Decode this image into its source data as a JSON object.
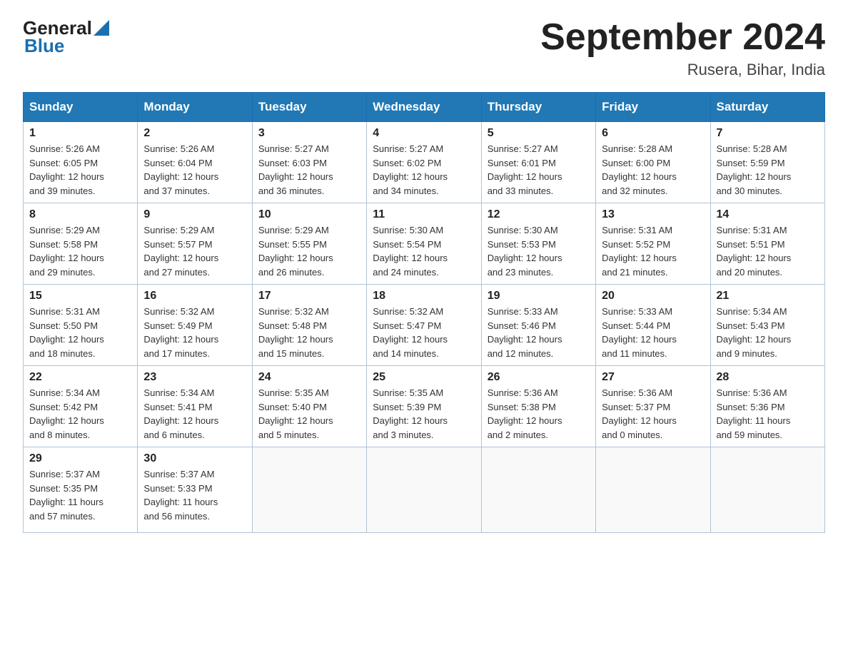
{
  "header": {
    "logo_general": "General",
    "logo_blue": "Blue",
    "title": "September 2024",
    "subtitle": "Rusera, Bihar, India"
  },
  "days_of_week": [
    "Sunday",
    "Monday",
    "Tuesday",
    "Wednesday",
    "Thursday",
    "Friday",
    "Saturday"
  ],
  "weeks": [
    [
      {
        "day": "1",
        "sunrise": "5:26 AM",
        "sunset": "6:05 PM",
        "daylight": "12 hours and 39 minutes."
      },
      {
        "day": "2",
        "sunrise": "5:26 AM",
        "sunset": "6:04 PM",
        "daylight": "12 hours and 37 minutes."
      },
      {
        "day": "3",
        "sunrise": "5:27 AM",
        "sunset": "6:03 PM",
        "daylight": "12 hours and 36 minutes."
      },
      {
        "day": "4",
        "sunrise": "5:27 AM",
        "sunset": "6:02 PM",
        "daylight": "12 hours and 34 minutes."
      },
      {
        "day": "5",
        "sunrise": "5:27 AM",
        "sunset": "6:01 PM",
        "daylight": "12 hours and 33 minutes."
      },
      {
        "day": "6",
        "sunrise": "5:28 AM",
        "sunset": "6:00 PM",
        "daylight": "12 hours and 32 minutes."
      },
      {
        "day": "7",
        "sunrise": "5:28 AM",
        "sunset": "5:59 PM",
        "daylight": "12 hours and 30 minutes."
      }
    ],
    [
      {
        "day": "8",
        "sunrise": "5:29 AM",
        "sunset": "5:58 PM",
        "daylight": "12 hours and 29 minutes."
      },
      {
        "day": "9",
        "sunrise": "5:29 AM",
        "sunset": "5:57 PM",
        "daylight": "12 hours and 27 minutes."
      },
      {
        "day": "10",
        "sunrise": "5:29 AM",
        "sunset": "5:55 PM",
        "daylight": "12 hours and 26 minutes."
      },
      {
        "day": "11",
        "sunrise": "5:30 AM",
        "sunset": "5:54 PM",
        "daylight": "12 hours and 24 minutes."
      },
      {
        "day": "12",
        "sunrise": "5:30 AM",
        "sunset": "5:53 PM",
        "daylight": "12 hours and 23 minutes."
      },
      {
        "day": "13",
        "sunrise": "5:31 AM",
        "sunset": "5:52 PM",
        "daylight": "12 hours and 21 minutes."
      },
      {
        "day": "14",
        "sunrise": "5:31 AM",
        "sunset": "5:51 PM",
        "daylight": "12 hours and 20 minutes."
      }
    ],
    [
      {
        "day": "15",
        "sunrise": "5:31 AM",
        "sunset": "5:50 PM",
        "daylight": "12 hours and 18 minutes."
      },
      {
        "day": "16",
        "sunrise": "5:32 AM",
        "sunset": "5:49 PM",
        "daylight": "12 hours and 17 minutes."
      },
      {
        "day": "17",
        "sunrise": "5:32 AM",
        "sunset": "5:48 PM",
        "daylight": "12 hours and 15 minutes."
      },
      {
        "day": "18",
        "sunrise": "5:32 AM",
        "sunset": "5:47 PM",
        "daylight": "12 hours and 14 minutes."
      },
      {
        "day": "19",
        "sunrise": "5:33 AM",
        "sunset": "5:46 PM",
        "daylight": "12 hours and 12 minutes."
      },
      {
        "day": "20",
        "sunrise": "5:33 AM",
        "sunset": "5:44 PM",
        "daylight": "12 hours and 11 minutes."
      },
      {
        "day": "21",
        "sunrise": "5:34 AM",
        "sunset": "5:43 PM",
        "daylight": "12 hours and 9 minutes."
      }
    ],
    [
      {
        "day": "22",
        "sunrise": "5:34 AM",
        "sunset": "5:42 PM",
        "daylight": "12 hours and 8 minutes."
      },
      {
        "day": "23",
        "sunrise": "5:34 AM",
        "sunset": "5:41 PM",
        "daylight": "12 hours and 6 minutes."
      },
      {
        "day": "24",
        "sunrise": "5:35 AM",
        "sunset": "5:40 PM",
        "daylight": "12 hours and 5 minutes."
      },
      {
        "day": "25",
        "sunrise": "5:35 AM",
        "sunset": "5:39 PM",
        "daylight": "12 hours and 3 minutes."
      },
      {
        "day": "26",
        "sunrise": "5:36 AM",
        "sunset": "5:38 PM",
        "daylight": "12 hours and 2 minutes."
      },
      {
        "day": "27",
        "sunrise": "5:36 AM",
        "sunset": "5:37 PM",
        "daylight": "12 hours and 0 minutes."
      },
      {
        "day": "28",
        "sunrise": "5:36 AM",
        "sunset": "5:36 PM",
        "daylight": "11 hours and 59 minutes."
      }
    ],
    [
      {
        "day": "29",
        "sunrise": "5:37 AM",
        "sunset": "5:35 PM",
        "daylight": "11 hours and 57 minutes."
      },
      {
        "day": "30",
        "sunrise": "5:37 AM",
        "sunset": "5:33 PM",
        "daylight": "11 hours and 56 minutes."
      },
      null,
      null,
      null,
      null,
      null
    ]
  ],
  "labels": {
    "sunrise": "Sunrise:",
    "sunset": "Sunset:",
    "daylight": "Daylight:"
  }
}
